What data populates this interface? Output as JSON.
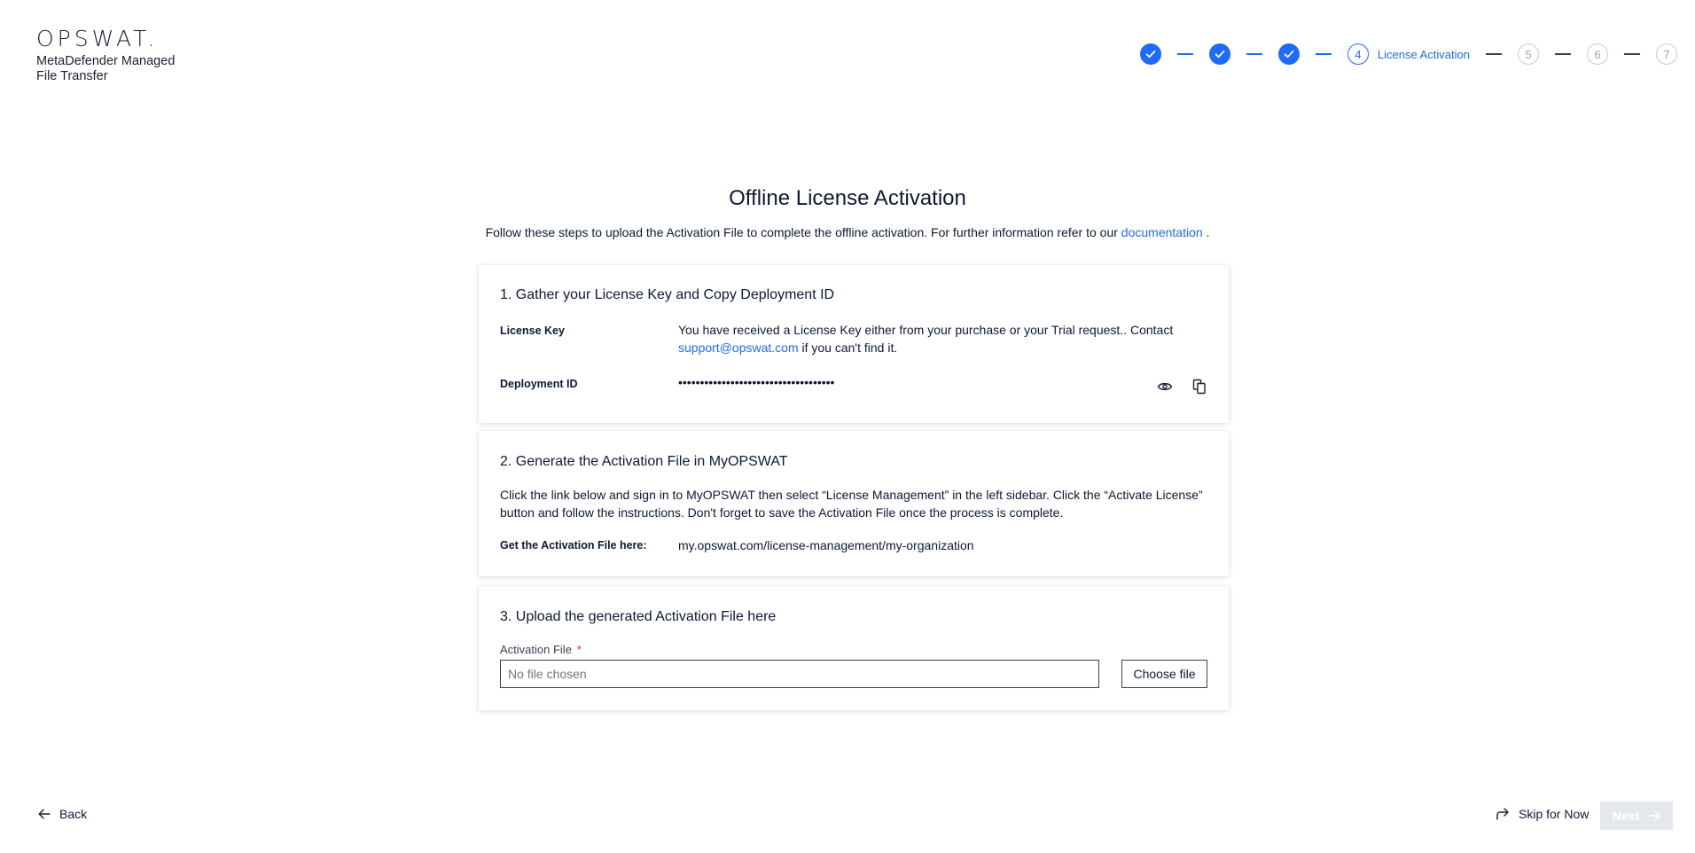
{
  "brand": {
    "logo": "OPSWAT.",
    "product": "MetaDefender Managed File Transfer"
  },
  "stepper": {
    "current_number": "4",
    "current_label": "License Activation",
    "future_steps": [
      "5",
      "6",
      "7"
    ]
  },
  "page": {
    "title": "Offline License Activation",
    "intro_text": "Follow these steps to upload the Activation File to complete the offline activation. For further information refer to our",
    "intro_link": "documentation",
    "intro_end": "."
  },
  "section1": {
    "title": "1. Gather your License Key and Copy Deployment ID",
    "license_label": "License Key",
    "license_text": "You have received a License Key either from your purchase or your Trial request.. Contact",
    "support_link": "support@opswat.com",
    "license_text_end": "if you can't find it.",
    "deployment_label": "Deployment ID",
    "deployment_masked": "••••••••••••••••••••••••••••••••••••"
  },
  "section2": {
    "title": "2. Generate the Activation File in MyOPSWAT",
    "body": "Click the link below and sign in to MyOPSWAT then select “License Management” in the left sidebar. Click the “Activate License” button and follow the instructions. Don't forget to save the Activation File once the process is complete.",
    "get_label": "Get the Activation File here:",
    "get_link": "my.opswat.com/license-management/my-organization"
  },
  "section3": {
    "title": "3. Upload the generated Activation File here",
    "field_label": "Activation File",
    "required_mark": "*",
    "placeholder": "No file chosen",
    "choose_label": "Choose file"
  },
  "footer": {
    "back_label": "Back",
    "skip_label": "Skip for Now",
    "next_label": "Next"
  },
  "colors": {
    "accent": "#1d6bfc",
    "text": "#0c1a33",
    "required": "#d92d20",
    "disabled": "#e4e7ec"
  }
}
